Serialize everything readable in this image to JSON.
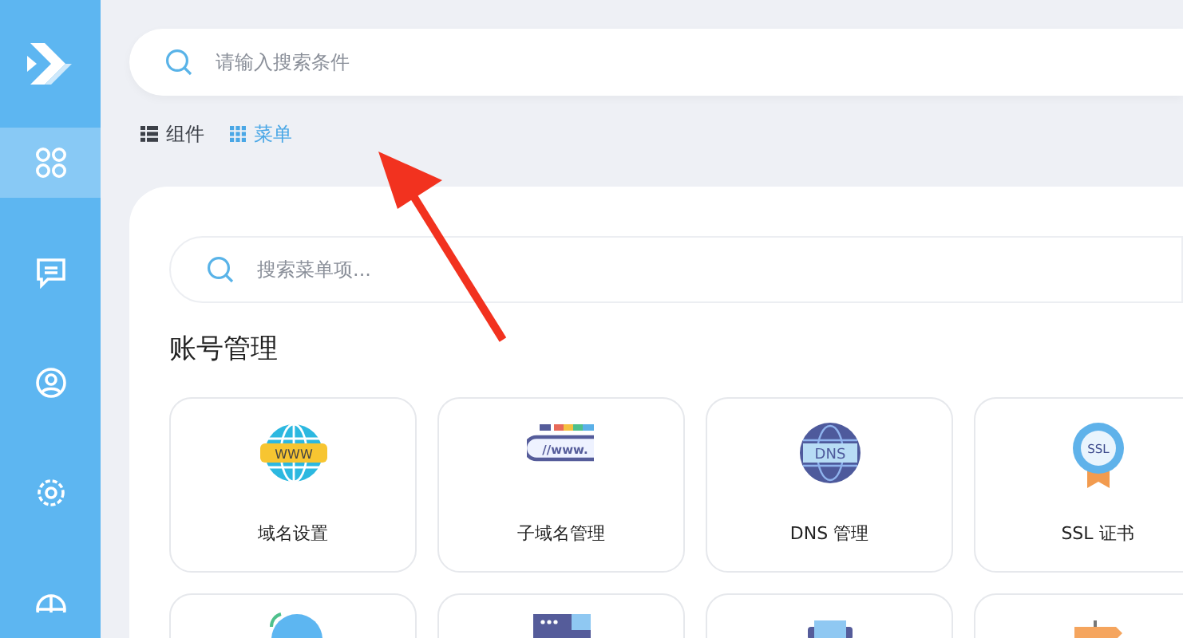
{
  "sidebar": {
    "items": [
      {
        "kind": "apps",
        "selected": true
      },
      {
        "kind": "chat",
        "selected": false
      },
      {
        "kind": "user",
        "selected": false
      },
      {
        "kind": "settings",
        "selected": false
      },
      {
        "kind": "globe",
        "selected": false
      }
    ]
  },
  "top_search": {
    "placeholder": "请输入搜索条件"
  },
  "tabs": [
    {
      "label": "组件",
      "kind": "list",
      "selected": false
    },
    {
      "label": "菜单",
      "kind": "grid",
      "selected": true
    }
  ],
  "panel": {
    "search": {
      "placeholder": "搜索菜单项..."
    },
    "heading": "账号管理",
    "cards": [
      {
        "icon_text": "WWW",
        "label": "域名设置"
      },
      {
        "icon_text": "//www.",
        "label": "子域名管理"
      },
      {
        "icon_text": "DNS",
        "label": "DNS 管理"
      },
      {
        "icon_text": "SSL",
        "label": "SSL 证书"
      }
    ]
  }
}
